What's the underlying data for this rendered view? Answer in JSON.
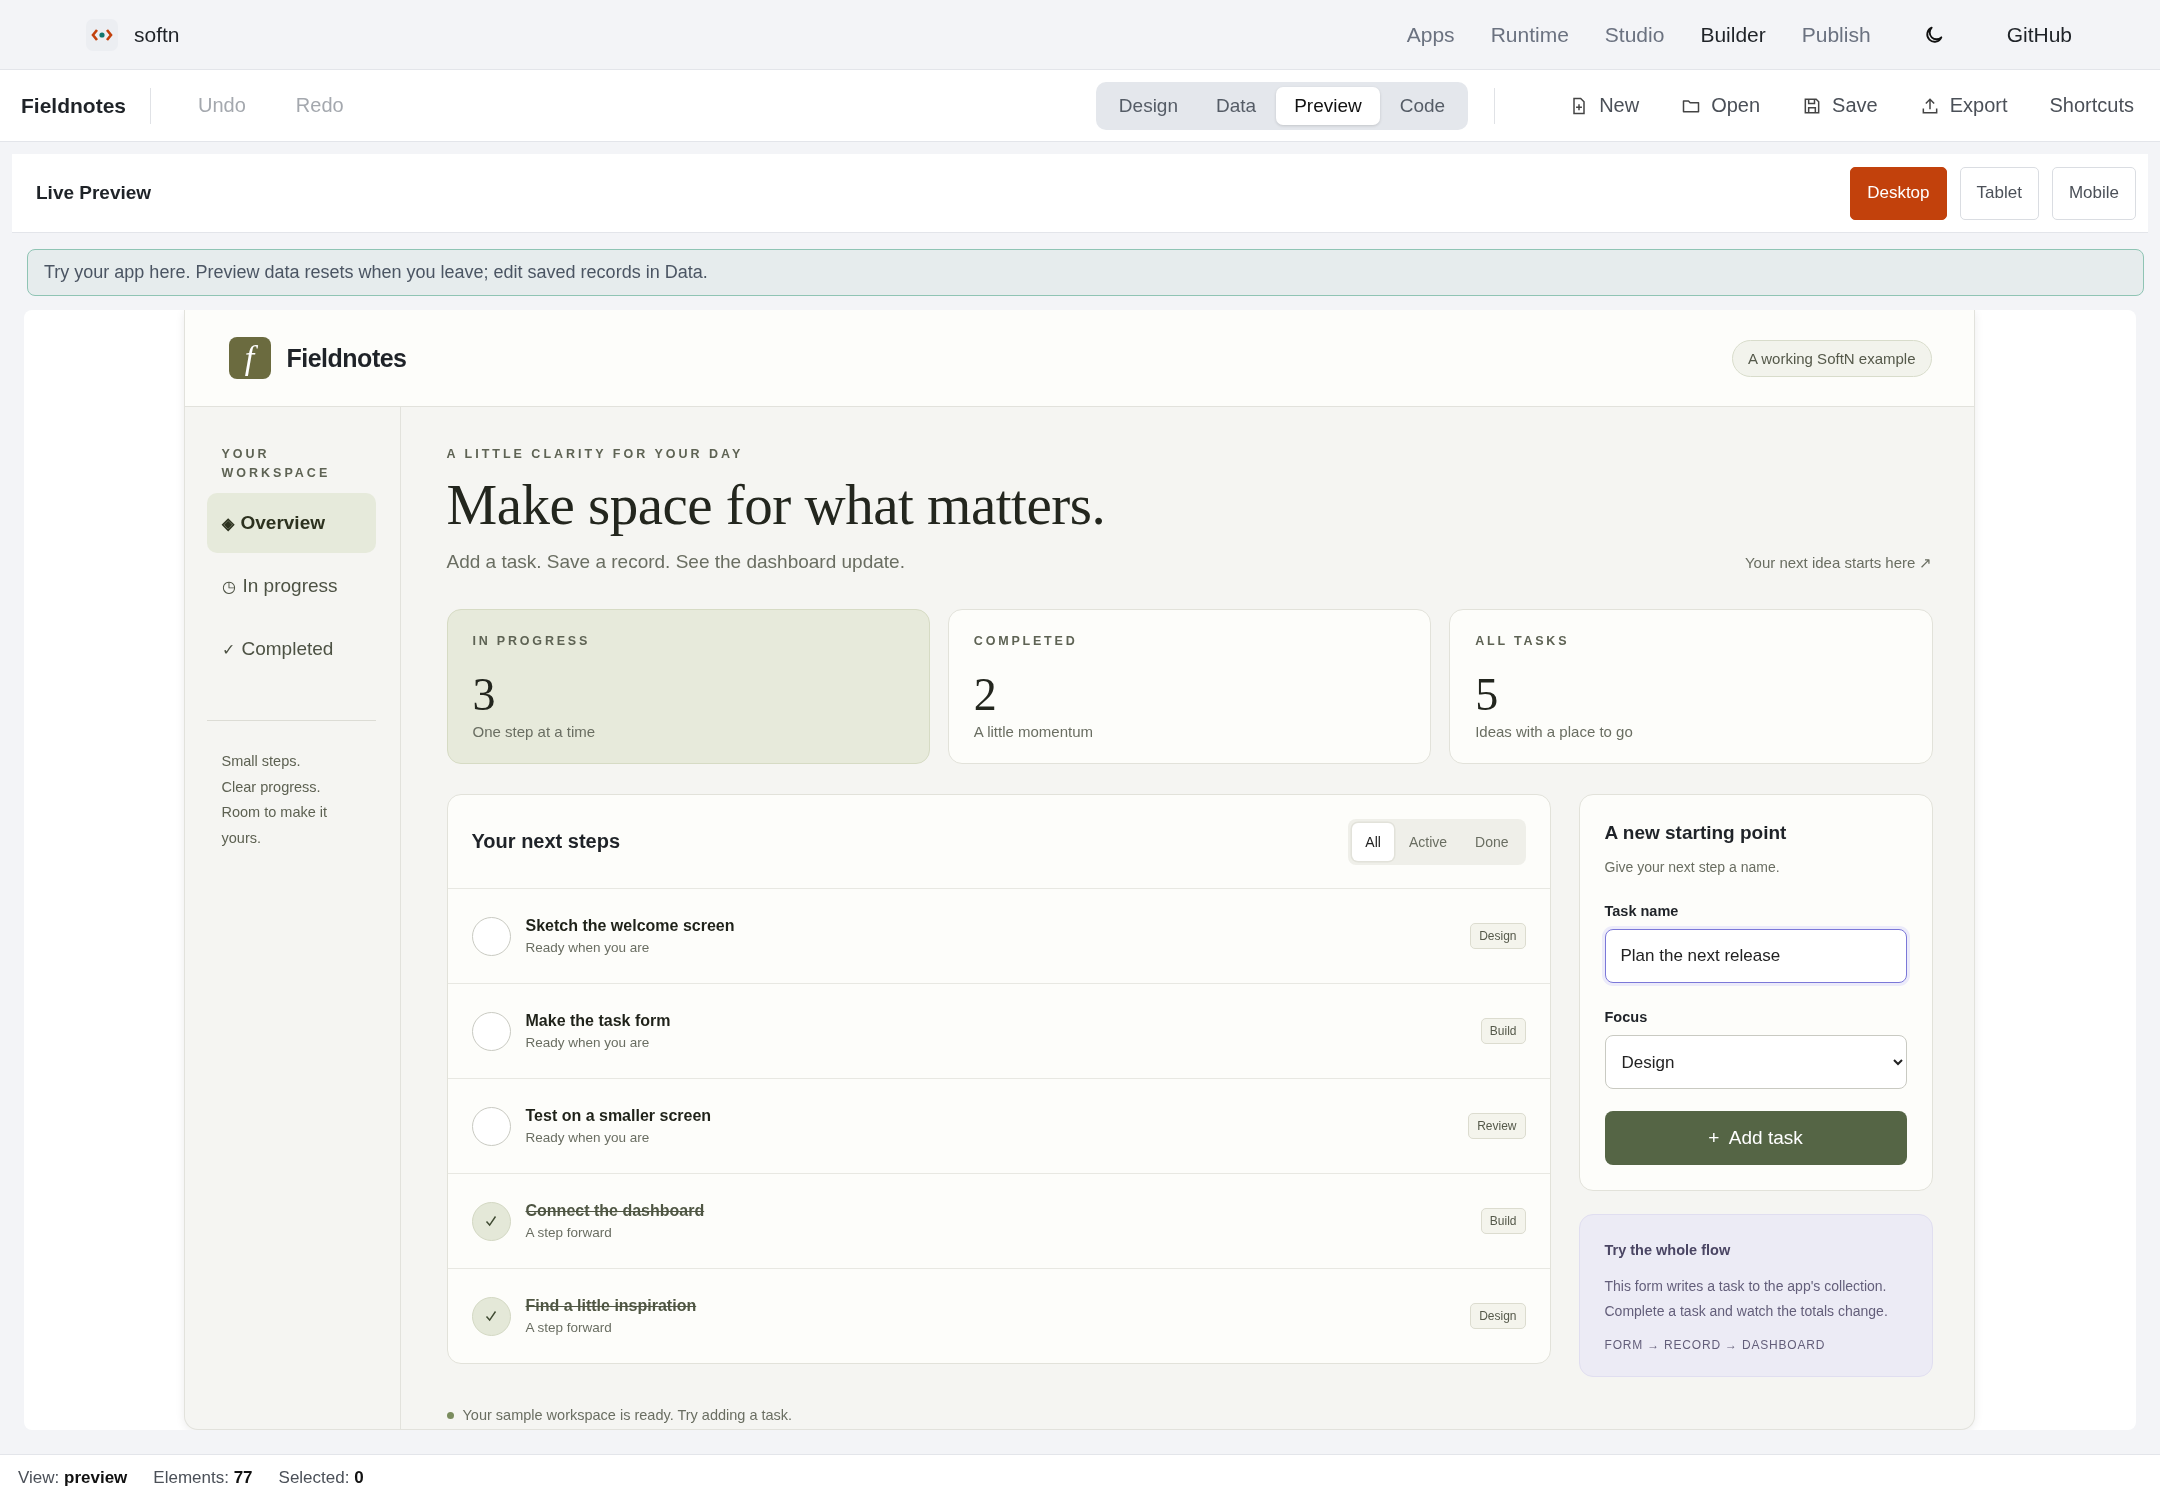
{
  "topnav": {
    "brand": "softn",
    "links": [
      {
        "label": "Apps",
        "selected": false
      },
      {
        "label": "Runtime",
        "selected": false
      },
      {
        "label": "Studio",
        "selected": false
      },
      {
        "label": "Builder",
        "selected": true
      },
      {
        "label": "Publish",
        "selected": false
      }
    ],
    "github": "GitHub"
  },
  "toolbar": {
    "title": "Fieldnotes",
    "history": [
      {
        "label": "Undo",
        "disabled": true
      },
      {
        "label": "Redo",
        "disabled": true
      }
    ],
    "modes": [
      {
        "label": "Design",
        "selected": false
      },
      {
        "label": "Data",
        "selected": false
      },
      {
        "label": "Preview",
        "selected": true
      },
      {
        "label": "Code",
        "selected": false
      }
    ],
    "actions": [
      {
        "label": "New",
        "kind": "new"
      },
      {
        "label": "Open",
        "kind": "open"
      },
      {
        "label": "Save",
        "kind": "save"
      },
      {
        "label": "Export",
        "kind": "export"
      },
      {
        "label": "Shortcuts",
        "kind": "plain"
      }
    ]
  },
  "preview": {
    "title": "Live Preview",
    "devices": [
      {
        "label": "Desktop",
        "selected": true
      },
      {
        "label": "Tablet",
        "selected": false
      },
      {
        "label": "Mobile",
        "selected": false
      }
    ],
    "banner": "Try your app here. Preview data resets when you leave; edit saved records in Data."
  },
  "app": {
    "brand_mark": "f",
    "brand": "Fieldnotes",
    "badge": "A working SoftN example",
    "sidebar": {
      "heading": "YOUR WORKSPACE",
      "items": [
        {
          "icon": "◈",
          "label": "Overview",
          "selected": true
        },
        {
          "icon": "◷",
          "label": "In progress",
          "selected": false
        },
        {
          "icon": "✓",
          "label": "Completed",
          "selected": false
        }
      ],
      "note": "Small steps. Clear progress. Room to make it yours."
    },
    "eyebrow": "A LITTLE CLARITY FOR YOUR DAY",
    "headline": "Make space for what matters.",
    "subtitle": "Add a task. Save a record. See the dashboard update.",
    "link": "Your next idea starts here ↗",
    "stats": [
      {
        "label": "IN PROGRESS",
        "value": "3",
        "caption": "One step at a time",
        "highlighted": true
      },
      {
        "label": "COMPLETED",
        "value": "2",
        "caption": "A little momentum",
        "highlighted": false
      },
      {
        "label": "ALL TASKS",
        "value": "5",
        "caption": "Ideas with a place to go",
        "highlighted": false
      }
    ],
    "tasks": {
      "title": "Your next steps",
      "filters": [
        {
          "label": "All",
          "selected": true
        },
        {
          "label": "Active",
          "selected": false
        },
        {
          "label": "Done",
          "selected": false
        }
      ],
      "tasks": [
        {
          "title": "Sketch the welcome screen",
          "subtitle": "Ready when you are",
          "tag": "Design",
          "done": false
        },
        {
          "title": "Make the task form",
          "subtitle": "Ready when you are",
          "tag": "Build",
          "done": false
        },
        {
          "title": "Test on a smaller screen",
          "subtitle": "Ready when you are",
          "tag": "Review",
          "done": false
        },
        {
          "title": "Connect the dashboard",
          "subtitle": "A step forward",
          "tag": "Build",
          "done": true
        },
        {
          "title": "Find a little inspiration",
          "subtitle": "A step forward",
          "tag": "Design",
          "done": true
        }
      ]
    },
    "form": {
      "title": "A new starting point",
      "hint": "Give your next step a name.",
      "name_label": "Task name",
      "name_value": "Plan the next release",
      "focus_label": "Focus",
      "focus_value": "Design",
      "button": "+  Add task"
    },
    "tip": {
      "title": "Try the whole flow",
      "text": "This form writes a task to the app's collection. Complete a task and watch the totals change.",
      "flow": "FORM → RECORD → DASHBOARD"
    },
    "footer": "Your sample workspace is ready. Try adding a task."
  },
  "status_bar": [
    "View: **preview**",
    "Elements: **77**",
    "Selected: **0**"
  ]
}
